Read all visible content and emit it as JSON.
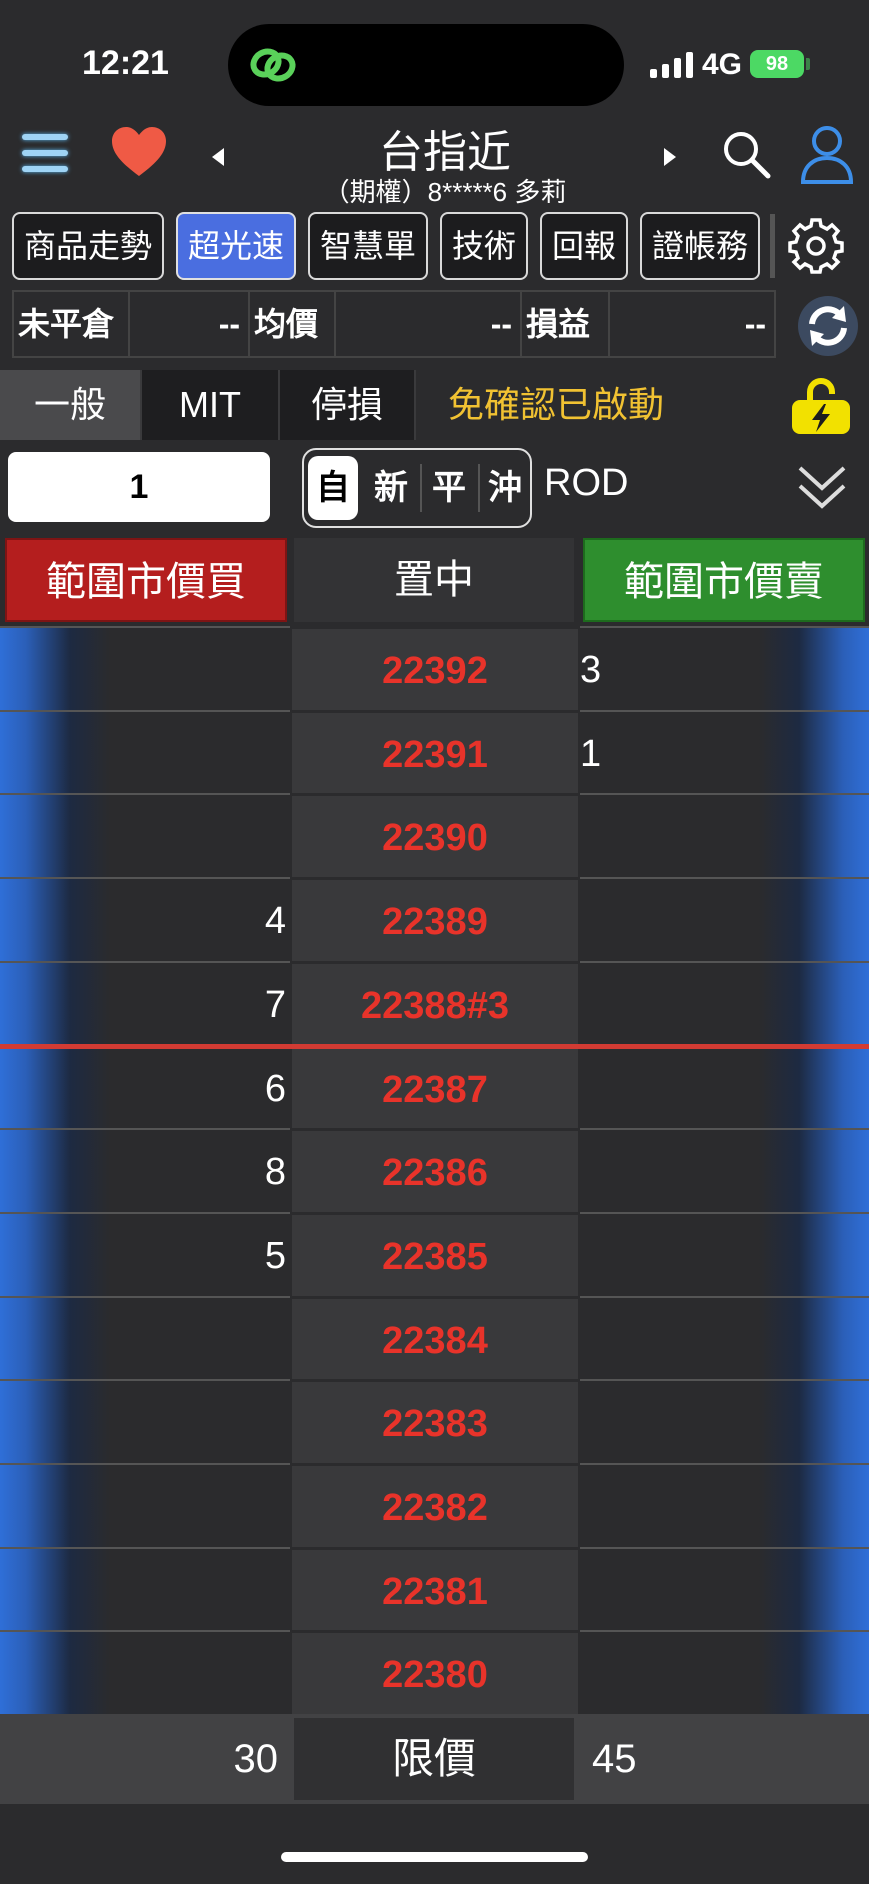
{
  "status_bar": {
    "time": "12:21",
    "network": "4G",
    "battery": "98"
  },
  "nav": {
    "title": "台指近",
    "account": "（期權）8*****6  多莉"
  },
  "tabs": [
    {
      "label": "商品走勢",
      "active": false
    },
    {
      "label": "超光速",
      "active": true
    },
    {
      "label": "智慧單",
      "active": false
    },
    {
      "label": "技術",
      "active": false
    },
    {
      "label": "回報",
      "active": false
    },
    {
      "label": "證帳務",
      "active": false
    }
  ],
  "summary": {
    "position_label": "未平倉",
    "position_value": "--",
    "avg_label": "均價",
    "avg_value": "--",
    "pnl_label": "損益",
    "pnl_value": "--"
  },
  "order_types": {
    "general": "一般",
    "mit": "MIT",
    "stop": "停損",
    "status": "免確認已啟動"
  },
  "order": {
    "quantity": "1",
    "modes": [
      "自",
      "新",
      "平",
      "沖"
    ],
    "selected_mode": "自",
    "time_in_force": "ROD"
  },
  "actions": {
    "buy": "範圍市價買",
    "center": "置中",
    "sell": "範圍市價賣"
  },
  "ladder": [
    {
      "price": "22392",
      "bid": "",
      "ask": "3"
    },
    {
      "price": "22391",
      "bid": "",
      "ask": "1"
    },
    {
      "price": "22390",
      "bid": "",
      "ask": ""
    },
    {
      "price": "22389",
      "bid": "4",
      "ask": ""
    },
    {
      "price": "22388#3",
      "bid": "7",
      "ask": ""
    },
    {
      "price": "22387",
      "bid": "6",
      "ask": ""
    },
    {
      "price": "22386",
      "bid": "8",
      "ask": ""
    },
    {
      "price": "22385",
      "bid": "5",
      "ask": ""
    },
    {
      "price": "22384",
      "bid": "",
      "ask": ""
    },
    {
      "price": "22383",
      "bid": "",
      "ask": ""
    },
    {
      "price": "22382",
      "bid": "",
      "ask": ""
    },
    {
      "price": "22381",
      "bid": "",
      "ask": ""
    },
    {
      "price": "22380",
      "bid": "",
      "ask": ""
    }
  ],
  "footer": {
    "bid_total": "30",
    "mode": "限價",
    "ask_total": "45"
  },
  "colors": {
    "buy": "#b41e1e",
    "sell": "#2e8e2e",
    "price": "#e8332a",
    "active_tab": "#4a6ee0",
    "status": "#f1c232"
  }
}
